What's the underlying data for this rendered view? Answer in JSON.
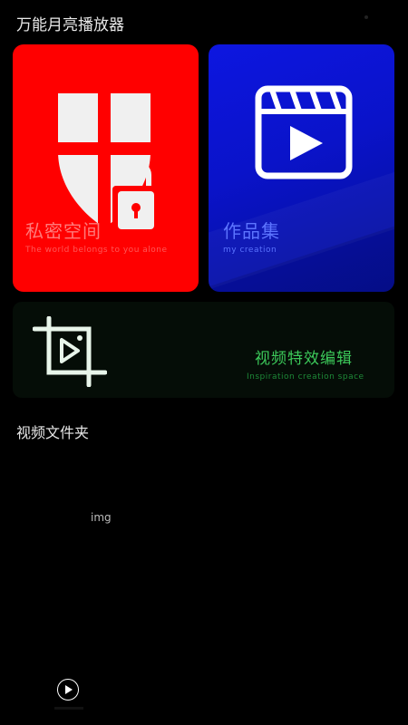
{
  "header": {
    "title": "万能月亮播放器"
  },
  "cards": {
    "private": {
      "title": "私密空间",
      "subtitle": "The world belongs to you alone"
    },
    "works": {
      "title": "作品集",
      "subtitle": "my creation"
    },
    "effects": {
      "title": "视频特效编辑",
      "subtitle": "Inspiration creation space"
    }
  },
  "folder_section": {
    "title": "视频文件夹",
    "item_image_alt": "img"
  },
  "icons": {
    "private": "shield-lock-icon",
    "works": "clapperboard-play-icon",
    "effects": "crop-video-icon",
    "bottom": "play-circle-icon"
  },
  "colors": {
    "private_card": "#ff0000",
    "works_card": "#0d16e0",
    "effects_text": "#3cc95a",
    "background": "#000000"
  }
}
